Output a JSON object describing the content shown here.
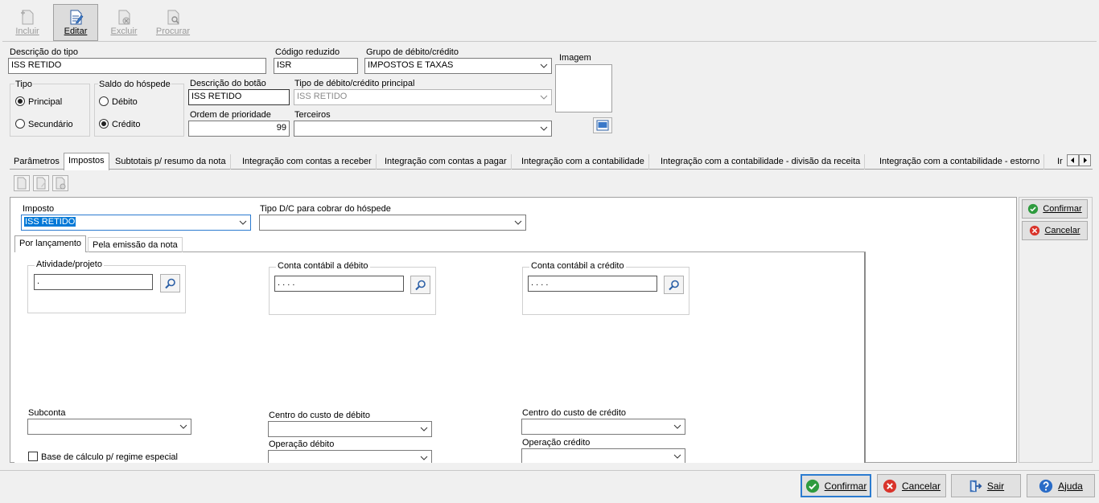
{
  "toolbar": {
    "incluir": "Incluir",
    "editar": "Editar",
    "excluir": "Excluir",
    "procurar": "Procurar"
  },
  "form": {
    "descricao_tipo": {
      "label": "Descrição do tipo",
      "value": "ISS RETIDO"
    },
    "codigo_reduzido": {
      "label": "Código reduzido",
      "value": "ISR"
    },
    "grupo": {
      "label": "Grupo de débito/crédito",
      "value": "IMPOSTOS E TAXAS"
    },
    "imagem": {
      "label": "Imagem"
    },
    "tipo": {
      "label": "Tipo",
      "options": [
        "Principal",
        "Secundário"
      ],
      "selected": "Principal"
    },
    "saldo": {
      "label": "Saldo do hóspede",
      "options": [
        "Débito",
        "Crédito"
      ],
      "selected": "Crédito"
    },
    "descricao_botao": {
      "label": "Descrição do botão",
      "value": "ISS RETIDO"
    },
    "tipo_principal": {
      "label": "Tipo de débito/crédito principal",
      "value": "ISS RETIDO"
    },
    "ordem": {
      "label": "Ordem de prioridade",
      "value": "99"
    },
    "terceiros": {
      "label": "Terceiros",
      "value": ""
    }
  },
  "tabs": [
    "Parâmetros",
    "Impostos",
    "Subtotais p/ resumo da nota",
    "Integração com contas a receber",
    "Integração com contas a pagar",
    "Integração com a contabilidade",
    "Integração com a contabilidade - divisão da receita",
    "Integração com a contabilidade - estorno",
    "Ir"
  ],
  "impostos": {
    "imposto": {
      "label": "Imposto",
      "value": "ISS RETIDO"
    },
    "tipo_dc": {
      "label": "Tipo D/C para cobrar do hóspede",
      "value": ""
    },
    "subtabs": [
      "Por lançamento",
      "Pela emissão da nota"
    ],
    "atividade": {
      "label": "Atividade/projeto",
      "value": "."
    },
    "conta_debito": {
      "label": "Conta contábil a débito",
      "value": ". . . ."
    },
    "conta_credito": {
      "label": "Conta contábil a crédito",
      "value": ". . . ."
    },
    "subconta": {
      "label": "Subconta"
    },
    "centro_debito": {
      "label": "Centro do custo de débito"
    },
    "centro_credito": {
      "label": "Centro do custo de crédito"
    },
    "operacao_debito": {
      "label": "Operação débito"
    },
    "operacao_credito": {
      "label": "Operação crédito"
    },
    "base_calculo": {
      "label": "Base de cálculo p/ regime especial"
    }
  },
  "side": {
    "confirmar": "Confirmar",
    "cancelar": "Cancelar"
  },
  "bottom": {
    "confirmar": "Confirmar",
    "cancelar": "Cancelar",
    "sair": "Sair",
    "ajuda": "Ajuda"
  },
  "colors": {
    "confirm_green": "#2e9b3e",
    "cancel_red": "#d9342b",
    "help_blue": "#2a6cc7",
    "selection_blue": "#0078d7"
  }
}
